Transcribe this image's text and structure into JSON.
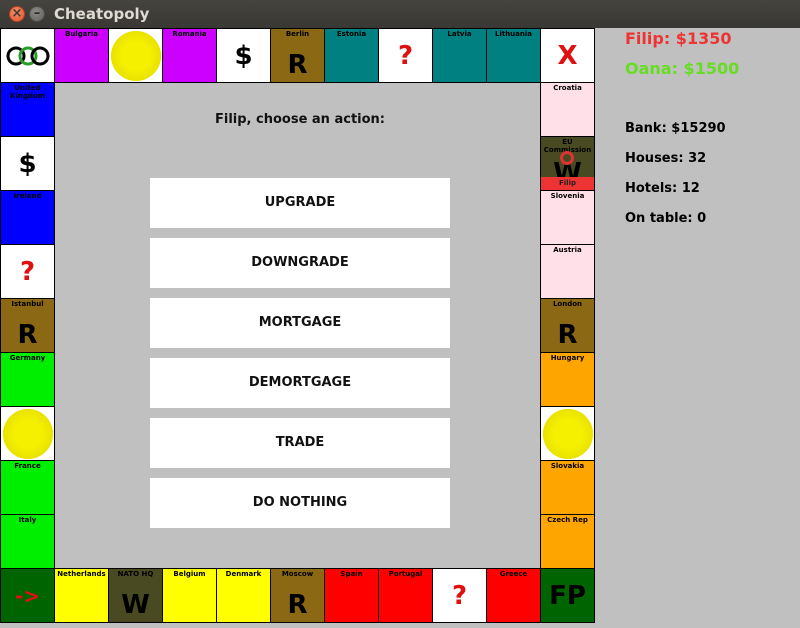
{
  "window": {
    "title": "Cheatopoly"
  },
  "players": [
    {
      "name": "Filip",
      "money": "$1350",
      "label": "Filip: $1350",
      "color": "#ee3333"
    },
    {
      "name": "Oana",
      "money": "$1500",
      "label": "Oana: $1500",
      "color": "#66dd22"
    }
  ],
  "stats": {
    "bank": "Bank: $15290",
    "houses": "Houses: 32",
    "hotels": "Hotels: 12",
    "on_table": "On table: 0"
  },
  "prompt": "Filip, choose an action:",
  "actions": [
    "UPGRADE",
    "DOWNGRADE",
    "MORTGAGE",
    "DEMORTGAGE",
    "TRADE",
    "DO NOTHING"
  ],
  "colors": {
    "purple": "#cc00ff",
    "teal": "#008080",
    "brown": "#8b6914",
    "blue": "#0000ff",
    "green": "#00ee00",
    "yellow": "#ffff00",
    "red": "#ff0000",
    "orange": "#ffa500",
    "pink": "#ffe0e8",
    "olive": "#4a4a22",
    "darkgreen": "#006400",
    "white": "#ffffff",
    "board_bg": "#c0c0c0",
    "sun": "#f5f000"
  },
  "cells": {
    "top": [
      {
        "name": "",
        "symbol": "GO-icon",
        "color": "white",
        "kind": "corner"
      },
      {
        "name": "Bulgaria",
        "symbol": "",
        "color": "purple"
      },
      {
        "name": "",
        "symbol": "",
        "color": "yellow-sun",
        "kind": "sun"
      },
      {
        "name": "Romania",
        "symbol": "",
        "color": "purple"
      },
      {
        "name": "",
        "symbol": "$",
        "color": "white"
      },
      {
        "name": "Berlin",
        "symbol": "R",
        "color": "brown"
      },
      {
        "name": "Estonia",
        "symbol": "",
        "color": "teal"
      },
      {
        "name": "",
        "symbol": "?",
        "color": "white"
      },
      {
        "name": "Latvia",
        "symbol": "",
        "color": "teal"
      },
      {
        "name": "Lithuania",
        "symbol": "",
        "color": "teal"
      },
      {
        "name": "",
        "symbol": "X",
        "color": "white",
        "kind": "corner"
      }
    ],
    "right": [
      {
        "name": "Croatia",
        "symbol": "",
        "color": "pink"
      },
      {
        "name": "EU Commission",
        "symbol": "W",
        "color": "olive",
        "owner": "Filip"
      },
      {
        "name": "Slovenia",
        "symbol": "",
        "color": "pink"
      },
      {
        "name": "Austria",
        "symbol": "",
        "color": "pink"
      },
      {
        "name": "London",
        "symbol": "R",
        "color": "brown"
      },
      {
        "name": "Hungary",
        "symbol": "",
        "color": "orange"
      },
      {
        "name": "",
        "symbol": "",
        "color": "sun",
        "kind": "sun"
      },
      {
        "name": "Slovakia",
        "symbol": "",
        "color": "orange"
      },
      {
        "name": "Czech Rep",
        "symbol": "",
        "color": "orange"
      }
    ],
    "bottom": [
      {
        "name": "",
        "symbol": "->",
        "color": "darkgreen",
        "kind": "corner"
      },
      {
        "name": "Netherlands",
        "symbol": "",
        "color": "yellow"
      },
      {
        "name": "NATO HQ",
        "symbol": "W",
        "color": "olive"
      },
      {
        "name": "Belgium",
        "symbol": "",
        "color": "yellow"
      },
      {
        "name": "Denmark",
        "symbol": "",
        "color": "yellow"
      },
      {
        "name": "Moscow",
        "symbol": "R",
        "color": "brown"
      },
      {
        "name": "Spain",
        "symbol": "",
        "color": "red"
      },
      {
        "name": "Portugal",
        "symbol": "",
        "color": "red"
      },
      {
        "name": "",
        "symbol": "?",
        "color": "white"
      },
      {
        "name": "Greece",
        "symbol": "",
        "color": "red"
      },
      {
        "name": "",
        "symbol": "FP",
        "color": "darkgreen",
        "kind": "corner"
      }
    ],
    "left": [
      {
        "name": "United Kingdom",
        "symbol": "",
        "color": "blue"
      },
      {
        "name": "",
        "symbol": "$",
        "color": "white"
      },
      {
        "name": "Ireland",
        "symbol": "",
        "color": "blue"
      },
      {
        "name": "",
        "symbol": "?",
        "color": "white"
      },
      {
        "name": "Istanbul",
        "symbol": "R",
        "color": "brown"
      },
      {
        "name": "Germany",
        "symbol": "",
        "color": "green"
      },
      {
        "name": "",
        "symbol": "",
        "color": "sun",
        "kind": "sun"
      },
      {
        "name": "France",
        "symbol": "",
        "color": "green"
      },
      {
        "name": "Italy",
        "symbol": "",
        "color": "green"
      }
    ]
  }
}
